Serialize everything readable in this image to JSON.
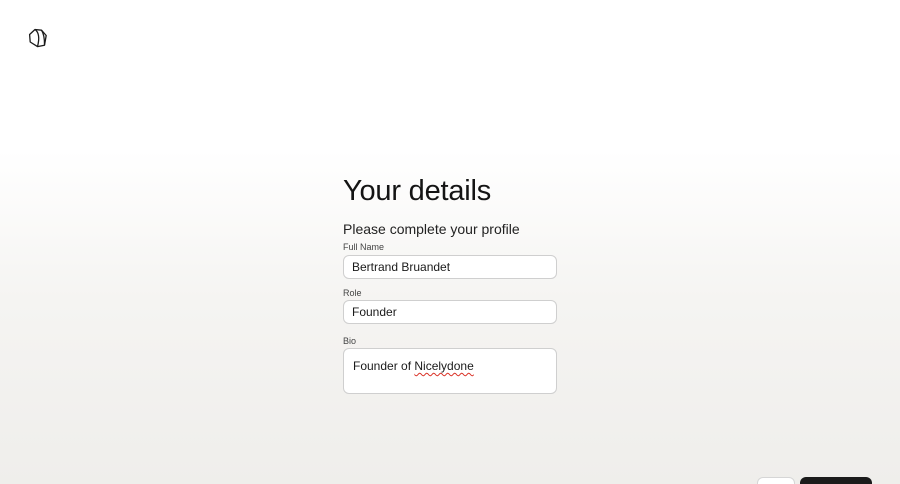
{
  "brand": {
    "logo_icon": "hexagon-outline-logo"
  },
  "page": {
    "title": "Your details",
    "subtitle": "Please complete your profile"
  },
  "form": {
    "full_name": {
      "label": "Full Name",
      "value": "Bertrand Bruandet"
    },
    "role": {
      "label": "Role",
      "value": "Founder"
    },
    "bio": {
      "label": "Bio",
      "value_prefix": "Founder of ",
      "value_misspelled": "Nicelydone"
    }
  },
  "footer": {
    "back_label": "",
    "next_label": ""
  },
  "colors": {
    "primary_button": "#1b1b1b",
    "input_border": "#cfcfcf",
    "spellcheck": "#d93025"
  }
}
